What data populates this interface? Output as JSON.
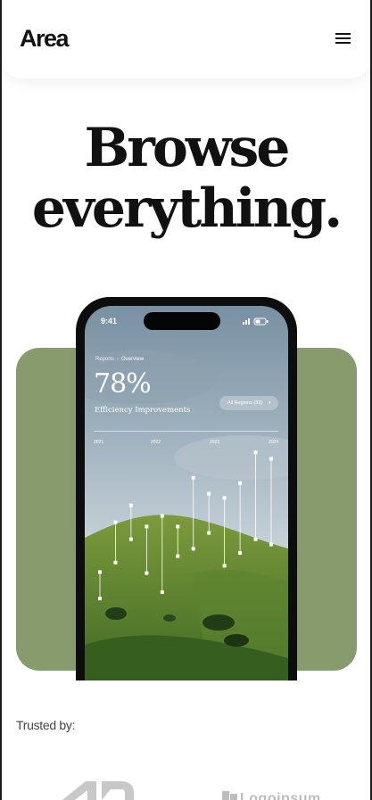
{
  "header": {
    "logo_text": "Area",
    "menu_icon": "hamburger-menu-icon"
  },
  "hero": {
    "headline_line1": "Browse",
    "headline_line2": "everything.",
    "card_color": "#879b6d"
  },
  "phone": {
    "status_time": "9:41",
    "breadcrumb": [
      "Reports",
      "Overview"
    ],
    "metric_value": "78%",
    "metric_label": "Efficiency Improvements",
    "region_filter": "All Regions (33)",
    "chart_years": [
      "2021",
      "2022",
      "2023",
      "2024"
    ]
  },
  "chart_data": {
    "type": "range",
    "x_label": "",
    "y_label": "",
    "categories": [
      "2021",
      "2022",
      "2023",
      "2024"
    ],
    "ranges": [
      {
        "low": 1.0,
        "high": 3.5
      },
      {
        "low": 4.4,
        "high": 8.2
      },
      {
        "low": 6.6,
        "high": 9.8
      },
      {
        "low": 3.4,
        "high": 7.8
      },
      {
        "low": 1.6,
        "high": 8.8
      },
      {
        "low": 5.0,
        "high": 7.8
      },
      {
        "low": 5.7,
        "high": 12.4
      },
      {
        "low": 7.2,
        "high": 10.9
      },
      {
        "low": 4.1,
        "high": 10.5
      },
      {
        "low": 5.3,
        "high": 11.9
      },
      {
        "low": 6.6,
        "high": 14.8
      },
      {
        "low": 6.1,
        "high": 14.2
      }
    ],
    "y_range": [
      0,
      16
    ]
  },
  "trusted": {
    "label": "Trusted by:",
    "partner_logo_2": "Logoipsum"
  }
}
